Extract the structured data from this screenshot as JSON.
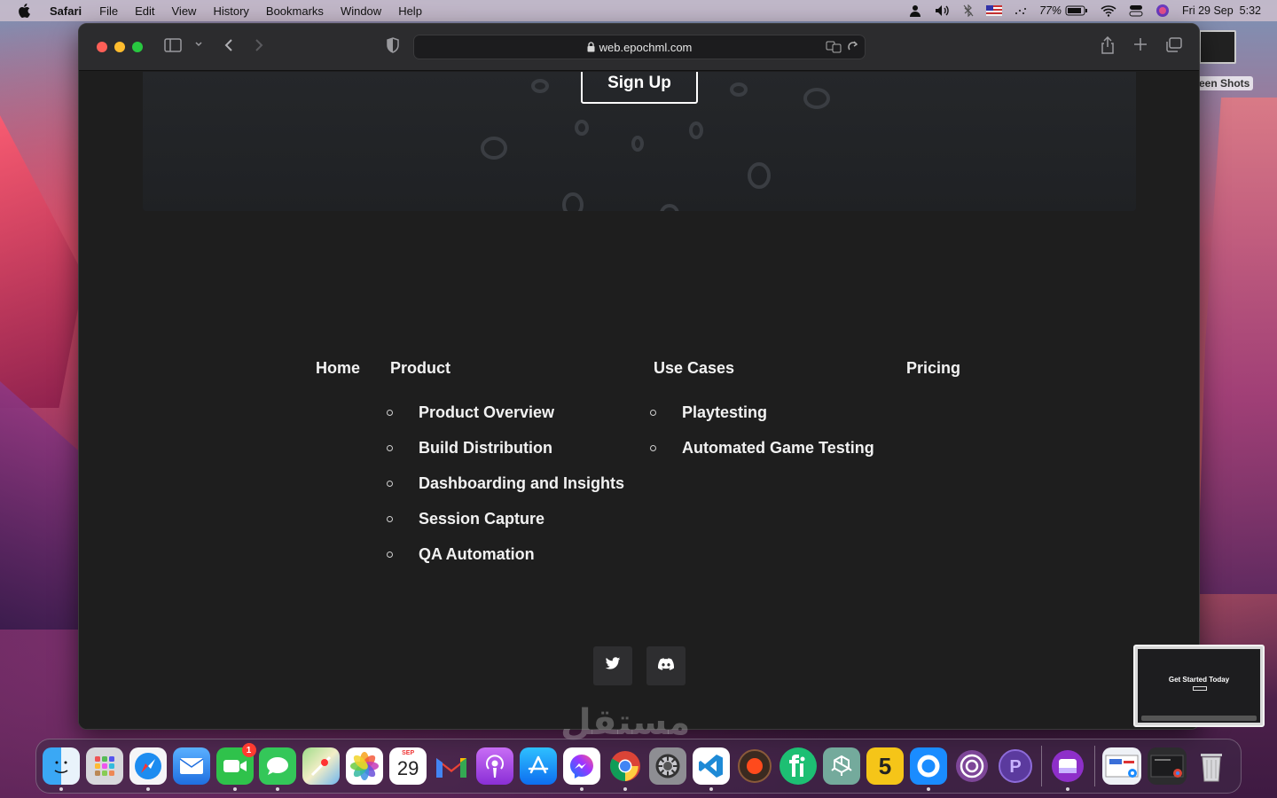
{
  "menubar": {
    "app_name": "Safari",
    "items": [
      "File",
      "Edit",
      "View",
      "History",
      "Bookmarks",
      "Window",
      "Help"
    ],
    "battery": "77%",
    "datetime": "Fri 29 Sep  5:32"
  },
  "desktop": {
    "screenshot_label": "een Shots"
  },
  "browser": {
    "url": "web.epochml.com"
  },
  "page": {
    "signup_label": "Sign Up",
    "nav": {
      "home": "Home",
      "product": {
        "heading": "Product",
        "items": [
          "Product Overview",
          "Build Distribution",
          "Dashboarding and Insights",
          "Session Capture",
          "QA Automation"
        ]
      },
      "use_cases": {
        "heading": "Use Cases",
        "items": [
          "Playtesting",
          "Automated Game Testing"
        ]
      },
      "pricing": "Pricing"
    },
    "social": [
      "twitter-icon",
      "discord-icon"
    ]
  },
  "preview": {
    "title": "Get Started Today"
  },
  "watermark": "مستقل",
  "dock": {
    "calendar_month": "SEP",
    "calendar_day": "29",
    "facetime_badge": "1",
    "apps": [
      "Finder",
      "Launchpad",
      "Safari",
      "Mail",
      "FaceTime",
      "Messages",
      "Maps",
      "Photos",
      "Calendar",
      "Gmail",
      "Podcasts",
      "App Store",
      "Messenger",
      "Chrome",
      "System Settings",
      "VS Code",
      "Record",
      "Fiverr",
      "ChatGPT",
      "5",
      "Quick",
      "Tor",
      "P",
      "Screen",
      "Downloads",
      "Window",
      "Trash"
    ]
  }
}
